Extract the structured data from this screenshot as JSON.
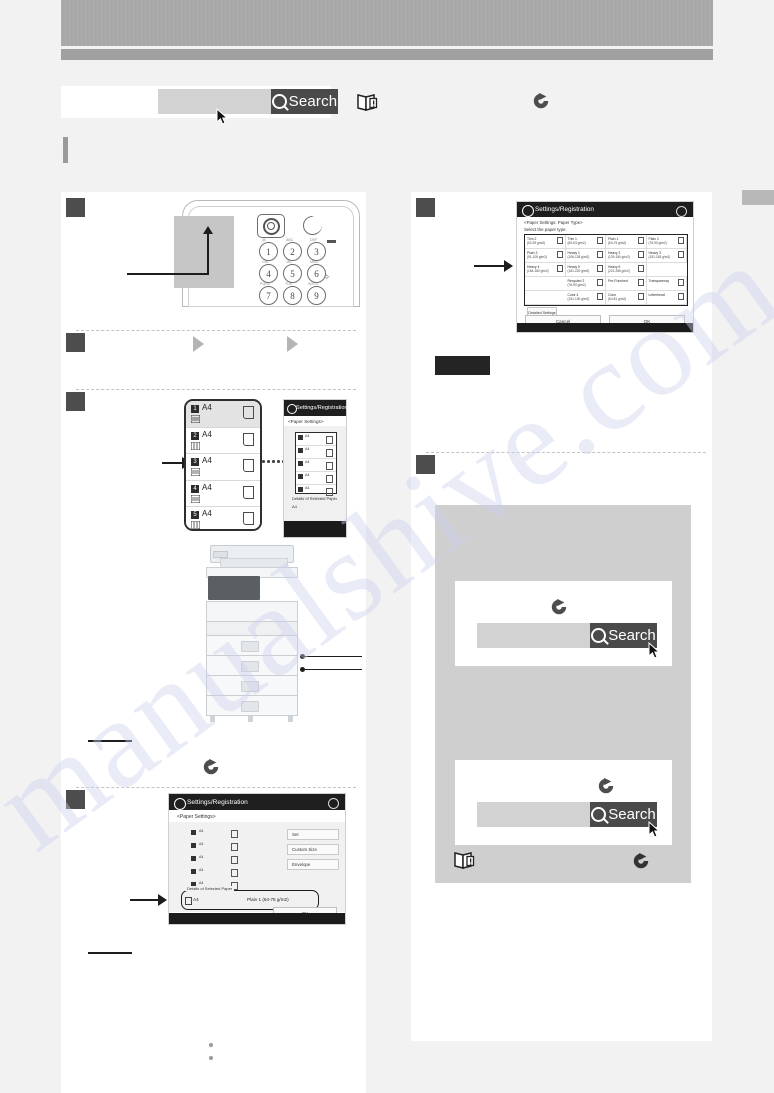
{
  "document": {
    "type": "printer-manual-scan",
    "watermark_text": "manualshive.com"
  },
  "header": {
    "search": {
      "value": "",
      "button_label": "Search",
      "search_icon": "magnifier-icon",
      "cursor_icon": "mouse-pointer-icon"
    },
    "book_icon": "open-book-warning-icon",
    "jump_icon": "circular-arrow-right-icon"
  },
  "left_column": {
    "steps": [
      {
        "number": "1",
        "illustration": "control-panel-keypad",
        "control_panel": {
          "settings_button_icon": "settings-registration-icon",
          "energy_saver_icon": "crescent-moon-icon",
          "keys": [
            "1",
            "2",
            "3",
            "4",
            "5",
            "6",
            "7",
            "8",
            "9"
          ],
          "key_sublabels": [
            "@.",
            "ABC",
            "DEF",
            "GHI",
            "JKL",
            "MNO",
            "PQRS",
            "TUV",
            "WXYZ"
          ],
          "clear_icon": "clear-diamond-icon"
        }
      },
      {
        "number": "2",
        "arrow_icons": [
          "play-triangle-icon",
          "play-triangle-icon"
        ]
      },
      {
        "number": "3",
        "drawer_list": {
          "rows": [
            {
              "num": "1",
              "size": "A4",
              "selected": true
            },
            {
              "num": "2",
              "size": "A4",
              "selected": false
            },
            {
              "num": "3",
              "size": "A4",
              "selected": false
            },
            {
              "num": "4",
              "size": "A4",
              "selected": false
            },
            {
              "num": "5",
              "size": "A4",
              "selected": false
            }
          ]
        },
        "mini_screen": {
          "title": "Settings/Registration",
          "breadcrumb": "<Paper Settings>",
          "rows": [
            {
              "num": "1",
              "size": "A4"
            },
            {
              "num": "2",
              "size": "A4"
            },
            {
              "num": "3",
              "size": "A4"
            },
            {
              "num": "4",
              "size": "A4"
            },
            {
              "num": "5",
              "size": "A4"
            }
          ],
          "detail_caption": "Details of Selected Paper",
          "detail_value": "A4"
        },
        "printer_illustration": "multifunction-printer",
        "callouts": [
          "",
          ""
        ],
        "jump_icon": "circular-arrow-right-icon"
      },
      {
        "number": "4",
        "big_screen": {
          "title": "Settings/Registration",
          "breadcrumb": "<Paper Settings>",
          "list_rows": [
            {
              "num": "1",
              "size": "A4"
            },
            {
              "num": "2",
              "size": "A4"
            },
            {
              "num": "3",
              "size": "A4"
            },
            {
              "num": "4",
              "size": "A4"
            },
            {
              "num": "5",
              "size": "A4"
            }
          ],
          "side_buttons": [
            "Set",
            "Custom Size",
            "Envelope"
          ],
          "detail_caption": "Details of Selected Paper",
          "detail_size": "A4",
          "detail_type": "Plain 1 (64-75 g/m2)",
          "ok_label": "OK",
          "gear_icon": "gear-icon"
        }
      }
    ],
    "bullets": [
      "",
      ""
    ]
  },
  "right_column": {
    "steps": [
      {
        "number": "5",
        "paper_type_screen": {
          "title": "Settings/Registration",
          "breadcrumb_line1": "<Paper Settings: Paper Type>",
          "breadcrumb_line2": "Select the paper type.",
          "gear_icon": "gear-icon",
          "paper_types": [
            {
              "name": "Thin 2",
              "weight": "(52-59 g/m2)",
              "checkbox": true
            },
            {
              "name": "Thin 1",
              "weight": "(60-63 g/m2)",
              "checkbox": true
            },
            {
              "name": "Plain 1",
              "weight": "(64-75 g/m2)",
              "checkbox": true
            },
            {
              "name": "Plain 2",
              "weight": "(76-90 g/m2)",
              "checkbox": true
            },
            {
              "name": "Plain 3",
              "weight": "(91-105 g/m2)",
              "checkbox": true
            },
            {
              "name": "Heavy 1",
              "weight": "(106-128 g/m2)",
              "checkbox": true
            },
            {
              "name": "Heavy 2",
              "weight": "(129-150 g/m2)",
              "checkbox": true
            },
            {
              "name": "Heavy 3",
              "weight": "(151-163 g/m2)",
              "checkbox": true
            },
            {
              "name": "Heavy 4",
              "weight": "(164-180 g/m2)",
              "checkbox": true
            },
            {
              "name": "Heavy 5",
              "weight": "(181-220 g/m2)",
              "checkbox": true
            },
            {
              "name": "Heavy 6",
              "weight": "(221-256 g/m2)",
              "checkbox": true
            },
            {
              "name": "",
              "weight": "",
              "checkbox": false
            },
            {
              "name": "",
              "weight": "",
              "checkbox": false
            },
            {
              "name": "Recycled 2",
              "weight": "(76-90 g/m2)",
              "checkbox": true
            },
            {
              "name": "Pre-Punched",
              "weight": "",
              "checkbox": true
            },
            {
              "name": "Transparency",
              "weight": "",
              "checkbox": true
            },
            {
              "name": "",
              "weight": "",
              "checkbox": false
            },
            {
              "name": "Color 4",
              "weight": "(151-130 g/m2)",
              "checkbox": true
            },
            {
              "name": "Color",
              "weight": "(64-81 g/m2)",
              "checkbox": true
            },
            {
              "name": "Letterhead",
              "weight": "",
              "checkbox": true
            }
          ],
          "default_settings_label": "Detailed Settings",
          "cancel_label": "Cancel",
          "ok_label": "OK"
        },
        "note_label": ""
      },
      {
        "number": "6",
        "gray_panel": {
          "cards": [
            {
              "arrow_icon": "circular-arrow-right-icon",
              "search_value": "",
              "search_button_label": "Search",
              "search_icon": "magnifier-icon",
              "cursor_icon": "mouse-pointer-icon"
            },
            {
              "arrow_icon": "circular-arrow-right-icon",
              "search_value": "",
              "search_button_label": "Search",
              "search_icon": "magnifier-icon",
              "cursor_icon": "mouse-pointer-icon"
            }
          ],
          "footer_book_icon": "open-book-warning-icon",
          "footer_arrow_icon": "circular-arrow-right-icon"
        }
      }
    ]
  },
  "colors": {
    "page_bg": "#f2f2f2",
    "masthead": "#a8a8a8",
    "step_marker": "#4d4d4d",
    "search_button": "#4a4a4a",
    "search_field": "#d2d2d2",
    "gray_panel": "#cfcfcf",
    "screen_titlebar": "#1e1e1e"
  }
}
